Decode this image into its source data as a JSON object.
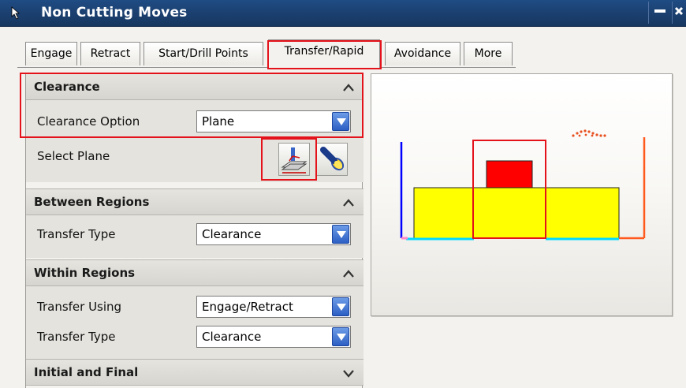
{
  "window": {
    "title": "Non Cutting Moves"
  },
  "tabs": [
    {
      "label": "Engage",
      "active": false
    },
    {
      "label": "Retract",
      "active": false
    },
    {
      "label": "Start/Drill Points",
      "active": false
    },
    {
      "label": "Transfer/Rapid",
      "active": true
    },
    {
      "label": "Avoidance",
      "active": false
    },
    {
      "label": "More",
      "active": false
    }
  ],
  "sections": {
    "clearance": {
      "title": "Clearance",
      "expanded": true,
      "clearance_option_label": "Clearance Option",
      "clearance_option_value": "Plane",
      "select_plane_label": "Select Plane"
    },
    "between_regions": {
      "title": "Between Regions",
      "expanded": true,
      "transfer_type_label": "Transfer Type",
      "transfer_type_value": "Clearance"
    },
    "within_regions": {
      "title": "Within Regions",
      "expanded": true,
      "transfer_using_label": "Transfer Using",
      "transfer_using_value": "Engage/Retract",
      "transfer_type_label": "Transfer Type",
      "transfer_type_value": "Clearance"
    },
    "initial_final": {
      "title": "Initial and Final",
      "expanded": false
    }
  },
  "icons": {
    "title": "select-arrow-icon",
    "collapse": "chevron-up-icon",
    "expand": "chevron-down-icon",
    "plane": "plane-dialog-icon",
    "spotlight": "flashlight-icon",
    "combo": "dropdown-arrow-icon"
  },
  "colors": {
    "title_bar": "#1b3f6e",
    "highlight": "#e4121a",
    "combo_button": "#2d5fc4",
    "part_fill": "#ffff00",
    "boss_fill": "#ff0000",
    "floor_line": "#00d8ff",
    "left_path": "#0000ff",
    "right_path": "#ff5a1e"
  }
}
